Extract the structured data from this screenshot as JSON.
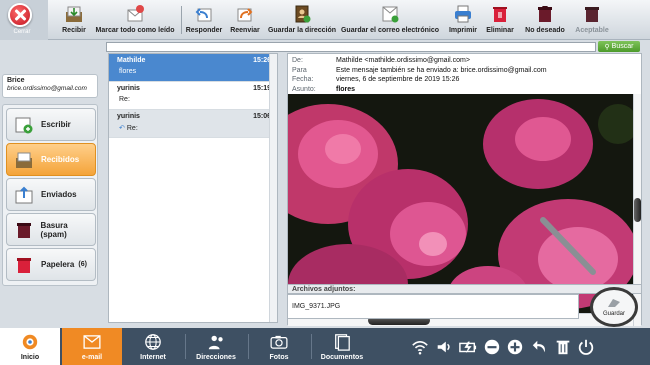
{
  "toolbar": {
    "close_label": "Cerrar",
    "buttons": [
      {
        "label": "Recibir",
        "icon": "inbox-receive-icon"
      },
      {
        "label": "Marcar todo como leído",
        "icon": "mark-read-icon"
      },
      {
        "label": "Responder",
        "icon": "reply-icon"
      },
      {
        "label": "Reenviar",
        "icon": "forward-icon"
      },
      {
        "label": "Guardar la dirección",
        "icon": "address-book-icon"
      },
      {
        "label": "Guardar el correo electrónico",
        "icon": "save-email-icon"
      },
      {
        "label": "Imprimir",
        "icon": "printer-icon"
      },
      {
        "label": "Eliminar",
        "icon": "delete-icon"
      },
      {
        "label": "No deseado",
        "icon": "spam-icon"
      },
      {
        "label": "Aceptable",
        "icon": "acceptable-icon"
      }
    ]
  },
  "search": {
    "placeholder": "",
    "button_label": "Buscar"
  },
  "user": {
    "name": "Brice",
    "email": "brice.ordissimo@gmail.com"
  },
  "folders": [
    {
      "label": "Escribir",
      "icon": "compose-icon",
      "count": ""
    },
    {
      "label": "Recibidos",
      "icon": "inbox-icon",
      "count": ""
    },
    {
      "label": "Enviados",
      "icon": "sent-icon",
      "count": ""
    },
    {
      "label": "Basura (spam)",
      "icon": "spam-bin-icon",
      "count": ""
    },
    {
      "label": "Papelera",
      "icon": "trash-icon",
      "count": "(6)"
    }
  ],
  "messages": [
    {
      "from": "Mathilde",
      "time": "15:26",
      "subject": "flores"
    },
    {
      "from": "yurinis",
      "time": "15:19",
      "subject": "Re:"
    },
    {
      "from": "yurinis",
      "time": "15:06",
      "subject": "Re:"
    }
  ],
  "reader": {
    "from_key": "De:",
    "from_val": "Mathilde <mathilde.ordissimo@gmail.com>",
    "to_key": "Para",
    "to_val": "Este mensaje también se ha enviado a:  brice.ordissimo@gmail.com",
    "date_key": "Fecha:",
    "date_val": "viernes, 6 de septiembre de 2019 15:26",
    "subject_key": "Asunto:",
    "subject_val": "flores"
  },
  "attachments": {
    "header": "Archivos adjuntos:",
    "file": "IMG_9371.JPG",
    "save_label": "Guardar"
  },
  "bottombar": {
    "items": [
      {
        "label": "Inicio",
        "icon": "home-logo-icon"
      },
      {
        "label": "e-mail",
        "icon": "email-icon"
      },
      {
        "label": "Internet",
        "icon": "globe-icon"
      },
      {
        "label": "Direcciones",
        "icon": "contacts-icon"
      },
      {
        "label": "Fotos",
        "icon": "camera-icon"
      },
      {
        "label": "Documentos",
        "icon": "documents-icon"
      }
    ]
  },
  "colors": {
    "accent": "#f08a24",
    "selected": "#4a88cf",
    "bar": "#3e5063"
  }
}
